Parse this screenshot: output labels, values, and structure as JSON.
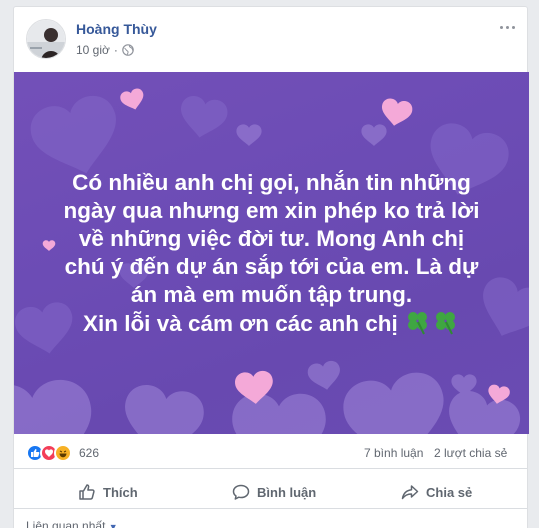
{
  "post": {
    "author": "Hoàng Thùy",
    "time": "10 giờ",
    "privacy_icon": "globe-icon",
    "status_lines": [
      "Có nhiều anh chị gọi, nhắn tin những",
      "ngày qua nhưng em xin phép ko trả lời",
      "về những việc đời tư. Mong Anh chị",
      "chú ý đến dự án sắp tới của em. Là dự",
      "án mà em muốn tập trung.",
      "Xin lỗi và cám ơn các anh chị"
    ],
    "background_color": "#6c4cb5"
  },
  "engagement": {
    "reaction_count": "626",
    "comments": "7 bình luận",
    "shares": "2 lượt chia sẻ"
  },
  "actions": {
    "like": "Thích",
    "comment": "Bình luận",
    "share": "Chia sẻ"
  },
  "footer": {
    "sort_label": "Liên quan nhất"
  },
  "colors": {
    "link": "#365899",
    "like_blue": "#1877f2",
    "love_red": "#f33e58",
    "haha_yellow": "#f7b125"
  }
}
